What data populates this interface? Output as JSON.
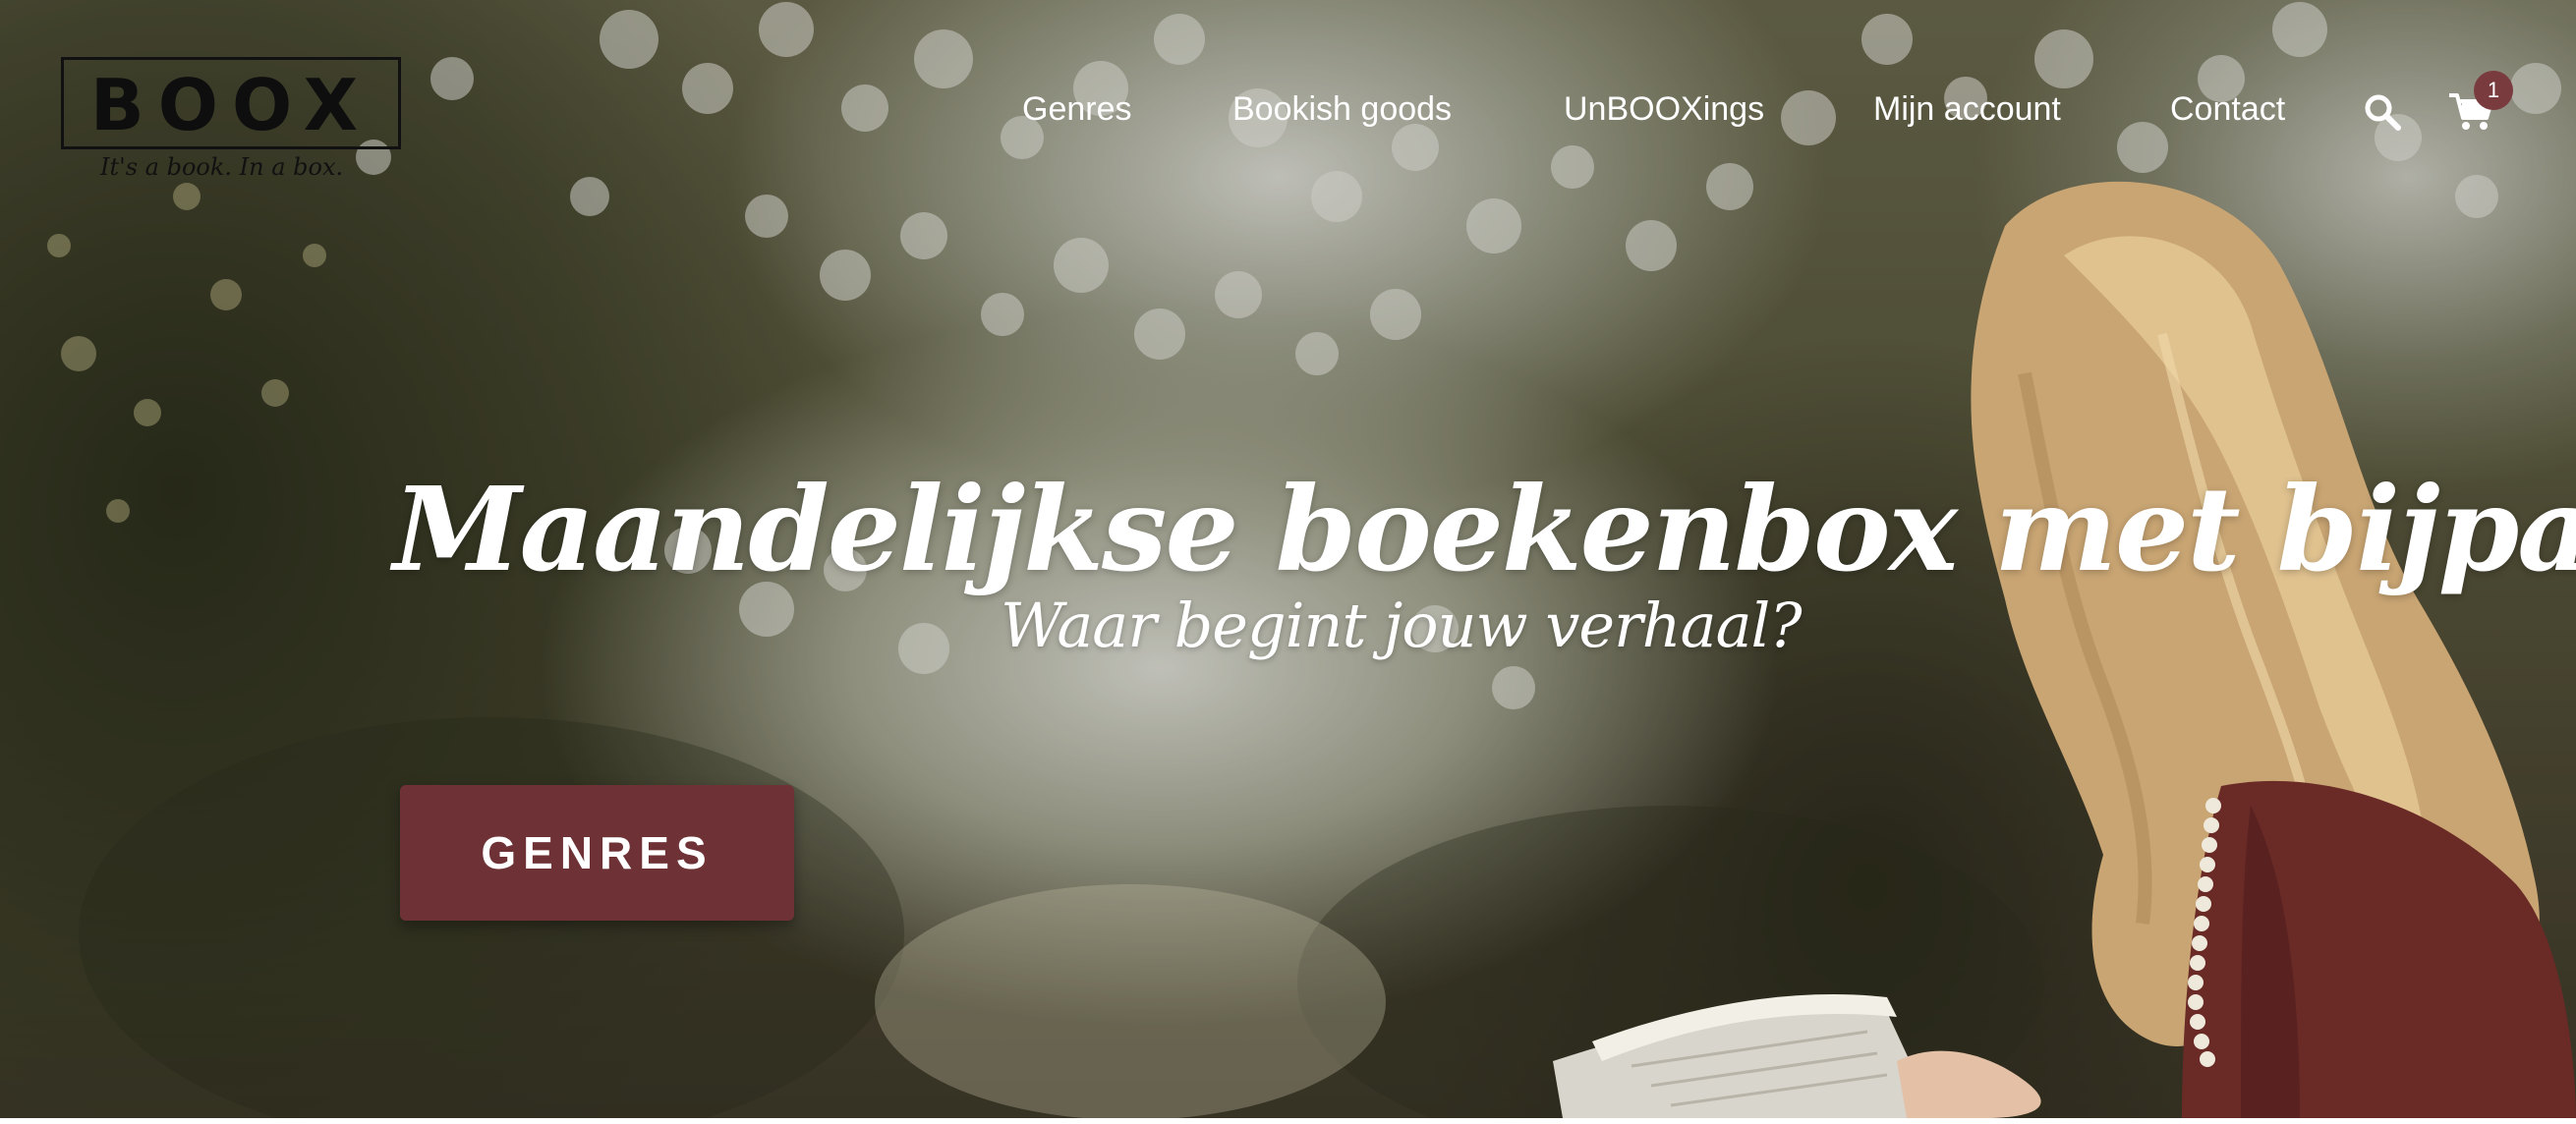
{
  "brand": {
    "logo_text": "BOOX",
    "tagline": "It's a book. In a box."
  },
  "nav": {
    "items": [
      {
        "label": "Genres"
      },
      {
        "label": "Bookish goods"
      },
      {
        "label": "UnBOOXings"
      },
      {
        "label": "Mijn account"
      },
      {
        "label": "Contact"
      }
    ],
    "search_icon": "search-icon",
    "cart_icon": "cart-icon",
    "cart_count": "1"
  },
  "hero": {
    "headline": "Maandelijkse boekenbox met bijpassende goodies",
    "subheadline": "Waar begint jouw verhaal?",
    "cta_label": "GENRES"
  },
  "colors": {
    "accent": "#6e3236",
    "badge": "#7a3b3f",
    "nav_text": "#ffffff"
  }
}
